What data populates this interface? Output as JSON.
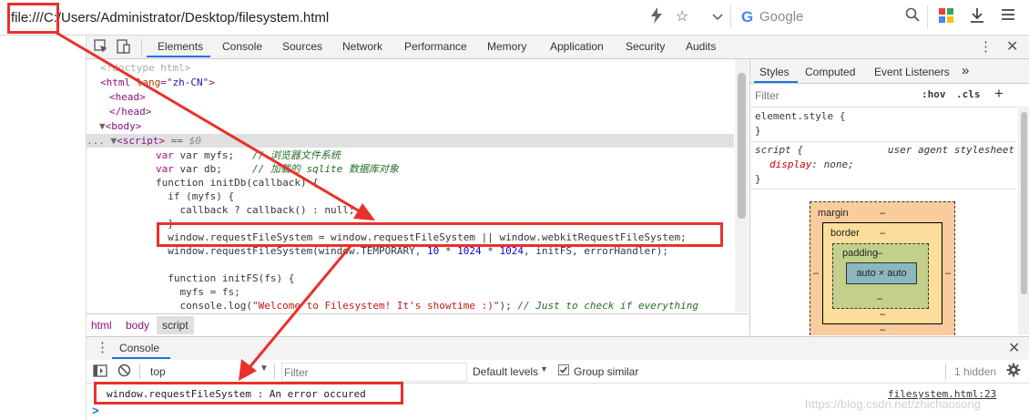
{
  "address": {
    "url": "file:///C:/Users/Administrator/Desktop/filesystem.html",
    "search_placeholder": "Google",
    "icons": [
      "lightning-icon",
      "star-icon",
      "chevron-down-icon",
      "google-logo-icon",
      "search-icon",
      "apps-icon",
      "download-icon",
      "menu-icon"
    ]
  },
  "devtools": {
    "tabs": [
      "Elements",
      "Console",
      "Sources",
      "Network",
      "Performance",
      "Memory",
      "Application",
      "Security",
      "Audits"
    ],
    "active_tab": "Elements"
  },
  "elements": {
    "lines": {
      "l0": "<!doctype html>",
      "l1_tag": "<html ",
      "l1_attr": "lang",
      "l1_eq": "=\"",
      "l1_val": "zh-CN",
      "l1_end": "\">",
      "l2": "<head>",
      "l3": "</head>",
      "l4": "<body>",
      "l5_dots": "...",
      "l5_tag": "<script>",
      "l5_eq": " == ",
      "l5_dollar": "$0",
      "l6_code": "var myfs;   ",
      "l6_cm": "// 浏览器文件系统",
      "l7_code": "var db;     ",
      "l7_cm": "// 加载的 sqlite 数据库对象",
      "l8": "function initDb(callback) {",
      "l9": "  if (myfs) {",
      "l10": "    callback ? callback() : null;",
      "l11": "  }",
      "l12": "  window.requestFileSystem = window.requestFileSystem || window.webkitRequestFileSystem;",
      "l13a": "  window.requestFileSystem(window.TEMPORARY, ",
      "l13n1": "10",
      "l13b": " * ",
      "l13n2": "1024",
      "l13c": " * ",
      "l13n3": "1024",
      "l13d": ", initFS, errorHandler);",
      "l14": "  function initFS(fs) {",
      "l15": "    myfs = fs;",
      "l16a": "    console.log(",
      "l16s": "\"Welcome to Filesystem! It's showtime :)\"",
      "l16b": "); ",
      "l16cm": "// Just to check if everything"
    }
  },
  "breadcrumb": [
    "html",
    "body",
    "script"
  ],
  "styles": {
    "tabs": [
      "Styles",
      "Computed",
      "Event Listeners"
    ],
    "more": "»",
    "filter_placeholder": "Filter",
    "hov": ":hov",
    "cls": ".cls",
    "add": "+",
    "rule1_selector": "element.style {",
    "rule1_close": "}",
    "rule2_selector": "script {",
    "rule2_source": "user agent stylesheet",
    "rule2_prop": "display",
    "rule2_val": "none;",
    "rule2_close": "}"
  },
  "box_model": {
    "margin_label": "margin",
    "border_label": "border",
    "padding_label": "padding",
    "dash": "–",
    "content": "auto × auto"
  },
  "console": {
    "header_label": "Console",
    "context": "top",
    "filter_placeholder": "Filter",
    "levels": "Default levels",
    "group_similar": "Group similar",
    "hidden_count": "1 hidden",
    "message": "window.requestFileSystem : An error occured",
    "source": "filesystem.html:23",
    "prompt": ">"
  },
  "watermark": "https://blog.csdn.net/zhichaosong",
  "colors": {
    "annotation_red": "#e8312a",
    "accent_blue": "#1a73e8"
  }
}
